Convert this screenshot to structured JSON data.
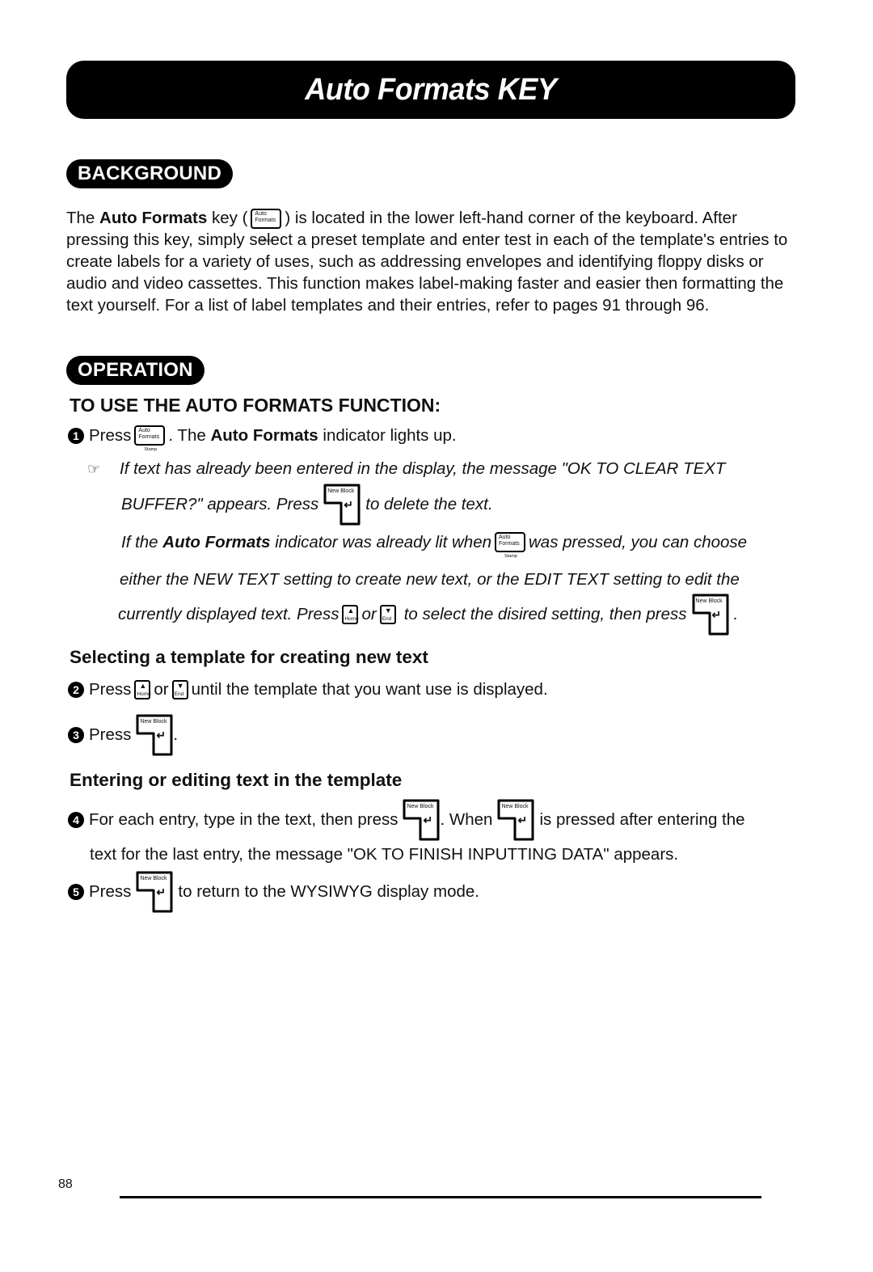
{
  "title": "Auto Formats KEY",
  "sections": {
    "background": "BACKGROUND",
    "operation": "OPERATION"
  },
  "keys": {
    "auto_formats": {
      "line1": "Auto",
      "line2": "Formats",
      "sub": "Stamp"
    },
    "home": {
      "arrow": "▲",
      "label": "Home"
    },
    "end": {
      "arrow": "▼",
      "label": "End"
    },
    "new_block": {
      "label": "New Block",
      "symbol": "↵"
    }
  },
  "background_para": {
    "p1": "The ",
    "bold": "Auto Formats",
    "p2": " key (",
    "p3": ") is located in the lower left-hand corner of the keyboard.  After pressing this key, simply select a preset template and enter test in each of the template's entries to create labels for a variety of uses, such as addressing envelopes and identifying floppy disks or audio and video cassettes. This function makes label-making faster and easier then formatting the text yourself.  For a list of label templates and their entries, refer to pages 91 through 96."
  },
  "heading_main": "TO USE THE AUTO FORMATS FUNCTION:",
  "step1": {
    "num": "1",
    "pre": "Press",
    "post1": ". The ",
    "bold": "Auto Formats",
    "post2": " indicator lights up."
  },
  "note": {
    "icon": "☞",
    "l1": "If text has already been entered in the display, the message \"OK TO CLEAR TEXT",
    "l2a": "BUFFER?\" appears.  Press",
    "l2b": "to delete the text.",
    "l3a": "If the ",
    "l3bold": "Auto Formats",
    "l3b": " indicator was already lit when",
    "l3c": "was pressed, you can choose",
    "l4": "either the NEW TEXT setting to create new text, or the EDIT TEXT setting to edit the",
    "l5a": "currently displayed text.  Press",
    "l5or": "or",
    "l5b": "to select the disired setting, then press",
    "l5end": "."
  },
  "heading_select": "Selecting a template for creating new text",
  "step2": {
    "num": "2",
    "pre": "Press",
    "or": "or",
    "post": "until the template that you want use is displayed."
  },
  "step3": {
    "num": "3",
    "pre": "Press",
    "post": "."
  },
  "heading_enter": "Entering or editing text in the template",
  "step4": {
    "num": "4",
    "pre": "For each entry, type in the text, then press",
    "mid": ". When",
    "post": "is pressed after entering the",
    "l2": "text for the last entry, the message \"OK TO FINISH INPUTTING DATA\" appears."
  },
  "step5": {
    "num": "5",
    "pre": "Press",
    "post": "to return to the WYSIWYG display mode."
  },
  "page_number": "88"
}
